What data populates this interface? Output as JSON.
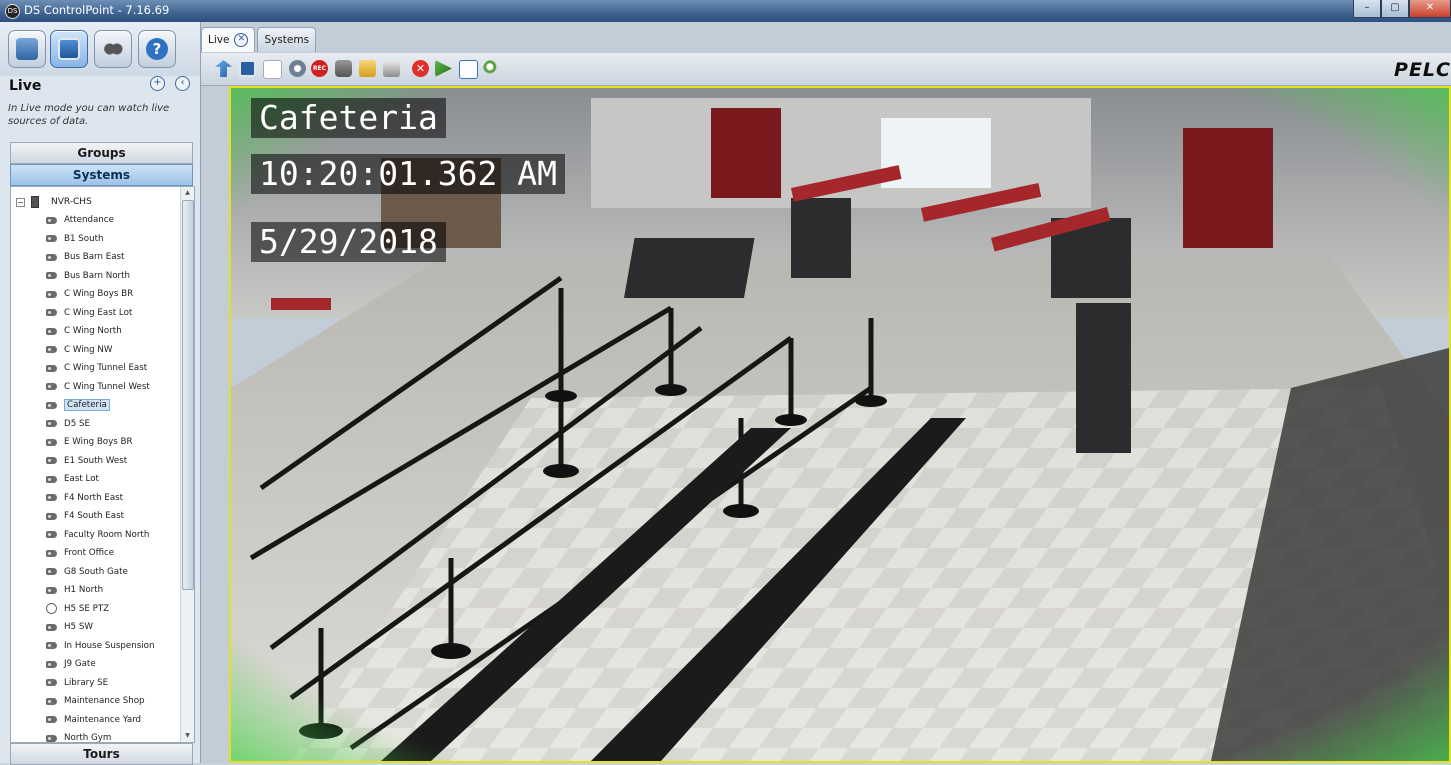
{
  "window": {
    "title": "DS ControlPoint - 7.16.69",
    "app_icon": "DS",
    "minimize": "–",
    "maximize": "▢",
    "close": "✕"
  },
  "nav": {
    "section_title": "Live",
    "description": "In Live mode you can watch live sources of data.",
    "groups_label": "Groups",
    "systems_label": "Systems",
    "tours_label": "Tours",
    "root": {
      "label": "NVR-CHS",
      "expander": "−"
    },
    "cameras": [
      {
        "label": "Attendance",
        "icon": "camera-icon"
      },
      {
        "label": "B1 South",
        "icon": "camera-icon"
      },
      {
        "label": "Bus Barn East",
        "icon": "camera-icon"
      },
      {
        "label": "Bus Barn North",
        "icon": "camera-icon"
      },
      {
        "label": "C Wing Boys BR",
        "icon": "camera-icon"
      },
      {
        "label": "C Wing East Lot",
        "icon": "camera-icon"
      },
      {
        "label": "C Wing North",
        "icon": "camera-icon"
      },
      {
        "label": "C Wing NW",
        "icon": "camera-icon"
      },
      {
        "label": "C Wing Tunnel East",
        "icon": "camera-icon"
      },
      {
        "label": "C Wing Tunnel West",
        "icon": "camera-icon"
      },
      {
        "label": "Cafeteria",
        "icon": "camera-icon",
        "selected": true
      },
      {
        "label": "D5 SE",
        "icon": "camera-icon"
      },
      {
        "label": "E Wing Boys BR",
        "icon": "camera-icon"
      },
      {
        "label": "E1 South West",
        "icon": "camera-icon"
      },
      {
        "label": "East Lot",
        "icon": "camera-icon"
      },
      {
        "label": "F4 North East",
        "icon": "camera-icon"
      },
      {
        "label": "F4 South East",
        "icon": "camera-icon"
      },
      {
        "label": "Faculty Room North",
        "icon": "camera-icon"
      },
      {
        "label": "Front Office",
        "icon": "camera-icon"
      },
      {
        "label": "G8 South Gate",
        "icon": "camera-icon"
      },
      {
        "label": "H1 North",
        "icon": "camera-icon"
      },
      {
        "label": "H5 SE PTZ",
        "icon": "ptz-camera-icon"
      },
      {
        "label": "H5 SW",
        "icon": "camera-icon"
      },
      {
        "label": "In House Suspension",
        "icon": "camera-icon"
      },
      {
        "label": "J9 Gate",
        "icon": "camera-icon"
      },
      {
        "label": "Library SE",
        "icon": "camera-icon"
      },
      {
        "label": "Maintenance Shop",
        "icon": "camera-icon"
      },
      {
        "label": "Maintenance Yard",
        "icon": "camera-icon"
      },
      {
        "label": "North Gym",
        "icon": "camera-icon"
      }
    ]
  },
  "tabs": [
    {
      "label": "Live",
      "active": true
    },
    {
      "label": "Systems",
      "active": false
    }
  ],
  "toolbar": {
    "icons": [
      "back-arrow-icon",
      "grid-layout-icon",
      "blank-layout-icon",
      "camera-settings-icon",
      "record-icon",
      "snapshot-icon",
      "folder-open-icon",
      "print-icon",
      "stop-icon",
      "ptz-icon",
      "edit-icon",
      "zoom-icon"
    ],
    "record_label": "REC",
    "brand": "PELC"
  },
  "video": {
    "camera_name": "Cafeteria",
    "time": "10:20:01.362 AM",
    "date": "5/29/2018",
    "border_color": "#e3e21c",
    "glow_color": "#46d146"
  },
  "colors": {
    "accent": "#6b97c5",
    "selection": "#cfe3f7"
  }
}
